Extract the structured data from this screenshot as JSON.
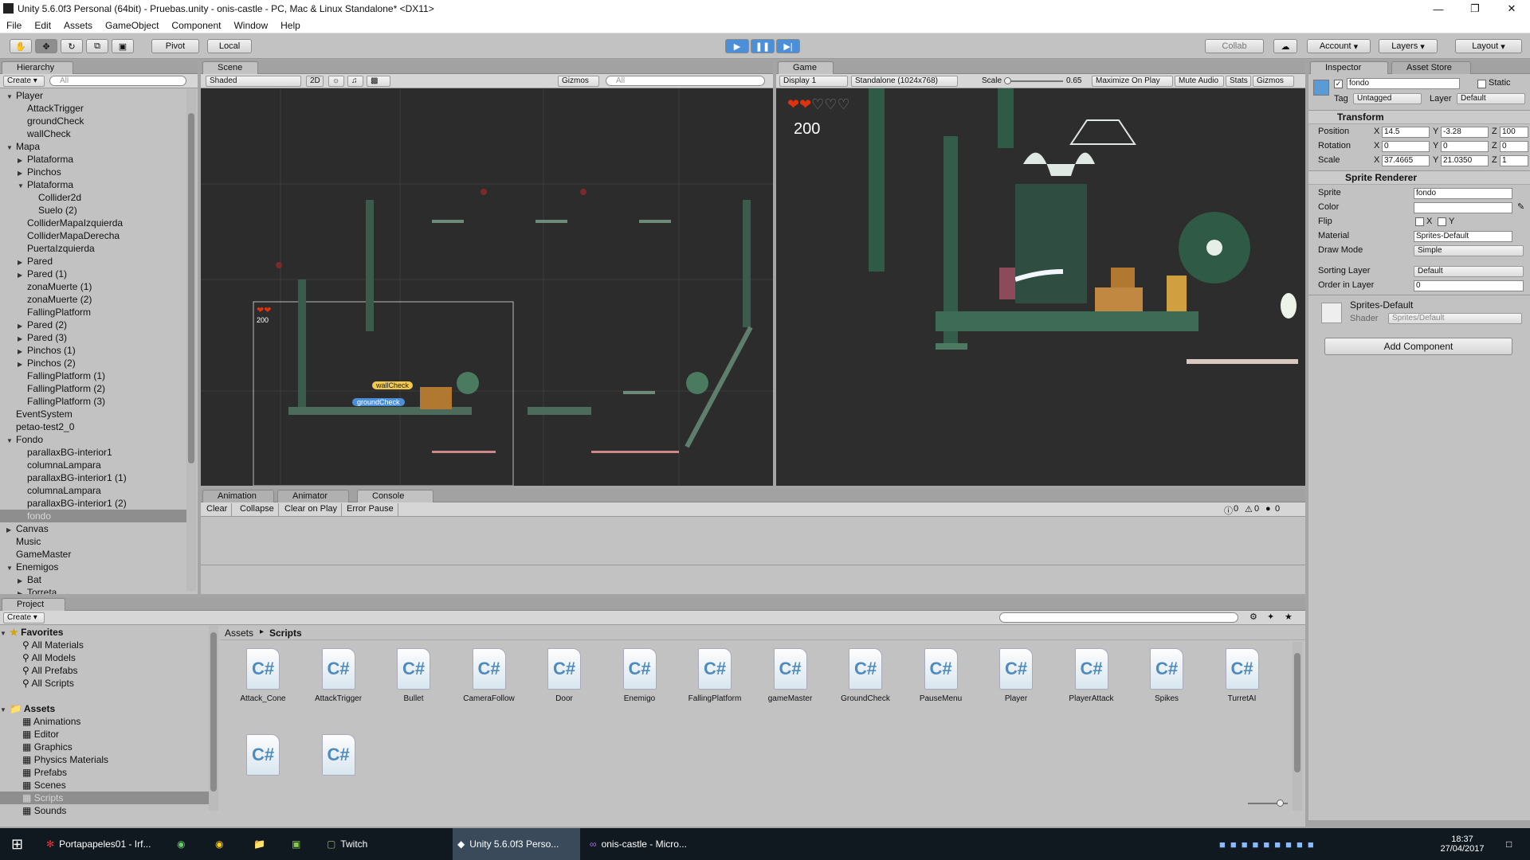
{
  "window": {
    "title": "Unity 5.6.0f3 Personal (64bit) - Pruebas.unity - onis-castle - PC, Mac & Linux Standalone* <DX11>"
  },
  "menu": [
    "File",
    "Edit",
    "Assets",
    "GameObject",
    "Component",
    "Window",
    "Help"
  ],
  "toolbar": {
    "pivot": "Pivot",
    "local": "Local",
    "collab": "Collab",
    "account": "Account",
    "layers": "Layers",
    "layout": "Layout"
  },
  "hierarchy": {
    "tab": "Hierarchy",
    "create": "Create",
    "search": "All",
    "items": [
      {
        "label": "Player",
        "indent": 0,
        "arrow": "open"
      },
      {
        "label": "AttackTrigger",
        "indent": 1,
        "arrow": ""
      },
      {
        "label": "groundCheck",
        "indent": 1,
        "arrow": ""
      },
      {
        "label": "wallCheck",
        "indent": 1,
        "arrow": ""
      },
      {
        "label": "Mapa",
        "indent": 0,
        "arrow": "open"
      },
      {
        "label": "Plataforma",
        "indent": 1,
        "arrow": "closed"
      },
      {
        "label": "Pinchos",
        "indent": 1,
        "arrow": "closed"
      },
      {
        "label": "Plataforma",
        "indent": 1,
        "arrow": "open"
      },
      {
        "label": "Collider2d",
        "indent": 2,
        "arrow": ""
      },
      {
        "label": "Suelo (2)",
        "indent": 2,
        "arrow": ""
      },
      {
        "label": "ColliderMapaIzquierda",
        "indent": 1,
        "arrow": ""
      },
      {
        "label": "ColliderMapaDerecha",
        "indent": 1,
        "arrow": ""
      },
      {
        "label": "PuertaIzquierda",
        "indent": 1,
        "arrow": ""
      },
      {
        "label": "Pared",
        "indent": 1,
        "arrow": "closed"
      },
      {
        "label": "Pared (1)",
        "indent": 1,
        "arrow": "closed"
      },
      {
        "label": "zonaMuerte (1)",
        "indent": 1,
        "arrow": ""
      },
      {
        "label": "zonaMuerte (2)",
        "indent": 1,
        "arrow": ""
      },
      {
        "label": "FallingPlatform",
        "indent": 1,
        "arrow": ""
      },
      {
        "label": "Pared (2)",
        "indent": 1,
        "arrow": "closed"
      },
      {
        "label": "Pared (3)",
        "indent": 1,
        "arrow": "closed"
      },
      {
        "label": "Pinchos (1)",
        "indent": 1,
        "arrow": "closed"
      },
      {
        "label": "Pinchos (2)",
        "indent": 1,
        "arrow": "closed"
      },
      {
        "label": "FallingPlatform (1)",
        "indent": 1,
        "arrow": ""
      },
      {
        "label": "FallingPlatform (2)",
        "indent": 1,
        "arrow": ""
      },
      {
        "label": "FallingPlatform (3)",
        "indent": 1,
        "arrow": ""
      },
      {
        "label": "EventSystem",
        "indent": 0,
        "arrow": ""
      },
      {
        "label": "petao-test2_0",
        "indent": 0,
        "arrow": ""
      },
      {
        "label": "Fondo",
        "indent": 0,
        "arrow": "open"
      },
      {
        "label": "parallaxBG-interior1",
        "indent": 1,
        "arrow": ""
      },
      {
        "label": "columnaLampara",
        "indent": 1,
        "arrow": ""
      },
      {
        "label": "parallaxBG-interior1 (1)",
        "indent": 1,
        "arrow": ""
      },
      {
        "label": "columnaLampara",
        "indent": 1,
        "arrow": ""
      },
      {
        "label": "parallaxBG-interior1 (2)",
        "indent": 1,
        "arrow": ""
      },
      {
        "label": "fondo",
        "indent": 1,
        "arrow": "",
        "selected": true
      },
      {
        "label": "Canvas",
        "indent": 0,
        "arrow": "closed"
      },
      {
        "label": "Music",
        "indent": 0,
        "arrow": ""
      },
      {
        "label": "GameMaster",
        "indent": 0,
        "arrow": ""
      },
      {
        "label": "Enemigos",
        "indent": 0,
        "arrow": "open"
      },
      {
        "label": "Bat",
        "indent": 1,
        "arrow": "closed"
      },
      {
        "label": "Torreta",
        "indent": 1,
        "arrow": "closed"
      }
    ]
  },
  "scene": {
    "tab": "Scene",
    "shading": "Shaded",
    "mode2d": "2D",
    "gizmos": "Gizmos",
    "search": "All",
    "labels": {
      "wallcheck": "wallCheck",
      "groundcheck": "groundCheck",
      "score": "200"
    }
  },
  "game": {
    "tab": "Game",
    "display": "Display 1",
    "resolution": "Standalone (1024x768)",
    "scale_label": "Scale",
    "scale_value": "0.65",
    "maximize": "Maximize On Play",
    "mute": "Mute Audio",
    "stats": "Stats",
    "gizmos": "Gizmos",
    "score": "200"
  },
  "bottom_tabs": {
    "animation": "Animation",
    "animator": "Animator",
    "console": "Console"
  },
  "console": {
    "clear": "Clear",
    "collapse": "Collapse",
    "clear_on_play": "Clear on Play",
    "error_pause": "Error Pause",
    "count_info": "0",
    "count_warn": "0",
    "count_err": "0"
  },
  "inspector": {
    "tab": "Inspector",
    "asset_store_tab": "Asset Store",
    "object_name": "fondo",
    "static": "Static",
    "tag_label": "Tag",
    "tag_value": "Untagged",
    "layer_label": "Layer",
    "layer_value": "Default",
    "transform": {
      "title": "Transform",
      "position_label": "Position",
      "rotation_label": "Rotation",
      "scale_label": "Scale",
      "position": {
        "x": "14.5",
        "y": "-3.28",
        "z": "100"
      },
      "rotation": {
        "x": "0",
        "y": "0",
        "z": "0"
      },
      "scale": {
        "x": "37.4665",
        "y": "21.0350",
        "z": "1"
      }
    },
    "sprite_renderer": {
      "title": "Sprite Renderer",
      "sprite_label": "Sprite",
      "sprite_value": "fondo",
      "color_label": "Color",
      "flip_label": "Flip",
      "flip_x": "X",
      "flip_y": "Y",
      "material_label": "Material",
      "material_value": "Sprites-Default",
      "drawmode_label": "Draw Mode",
      "drawmode_value": "Simple",
      "sorting_label": "Sorting Layer",
      "sorting_value": "Default",
      "order_label": "Order in Layer",
      "order_value": "0"
    },
    "material": {
      "name": "Sprites-Default",
      "shader_label": "Shader",
      "shader_value": "Sprites/Default"
    },
    "add_component": "Add Component"
  },
  "project": {
    "tab": "Project",
    "create": "Create",
    "favorites": {
      "title": "Favorites",
      "items": [
        "All Materials",
        "All Models",
        "All Prefabs",
        "All Scripts"
      ]
    },
    "assets": {
      "title": "Assets",
      "items": [
        "Animations",
        "Editor",
        "Graphics",
        "Physics Materials",
        "Prefabs",
        "Scenes",
        "Scripts",
        "Sounds"
      ]
    },
    "breadcrumb": {
      "root": "Assets",
      "current": "Scripts"
    },
    "scripts": [
      "Attack_Cone",
      "AttackTrigger",
      "Bullet",
      "CameraFollow",
      "Door",
      "Enemigo",
      "FallingPlatform",
      "gameMaster",
      "GroundCheck",
      "PauseMenu",
      "Player",
      "PlayerAttack",
      "Spikes",
      "TurretAI",
      "",
      ""
    ]
  },
  "taskbar": {
    "items": [
      {
        "label": "Portapapeles01 - Irf..."
      },
      {
        "label": ""
      },
      {
        "label": ""
      },
      {
        "label": ""
      },
      {
        "label": ""
      },
      {
        "label": "Twitch"
      },
      {
        "label": "Unity 5.6.0f3 Perso..."
      },
      {
        "label": "onis-castle - Micro..."
      }
    ],
    "time": "18:37",
    "date": "27/04/2017"
  }
}
